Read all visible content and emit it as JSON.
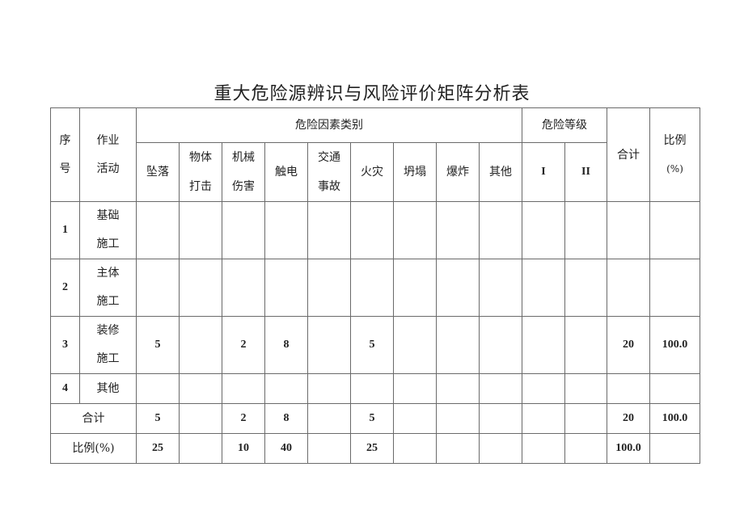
{
  "title": "重大危险源辨识与风险评价矩阵分析表",
  "header": {
    "seq": [
      "序",
      "号"
    ],
    "activity": [
      "作业",
      "活动"
    ],
    "hazard_group": "危险因素类别",
    "level_group": "危险等级",
    "total": "合计",
    "ratio": [
      "比例",
      "(%)"
    ],
    "hazard_types": [
      {
        "lines": [
          "坠落"
        ]
      },
      {
        "lines": [
          "物体",
          "打击"
        ]
      },
      {
        "lines": [
          "机械",
          "伤害"
        ]
      },
      {
        "lines": [
          "触电"
        ]
      },
      {
        "lines": [
          "交通",
          "事故"
        ]
      },
      {
        "lines": [
          "火灾"
        ]
      },
      {
        "lines": [
          "坍塌"
        ]
      },
      {
        "lines": [
          "爆炸"
        ]
      },
      {
        "lines": [
          "其他"
        ]
      }
    ],
    "levels": [
      "I",
      "II"
    ]
  },
  "rows": [
    {
      "seq": "1",
      "activity": [
        "基础",
        "施工"
      ],
      "values": [
        "",
        "",
        "",
        "",
        "",
        "",
        "",
        "",
        "",
        "",
        ""
      ],
      "total": "",
      "ratio": ""
    },
    {
      "seq": "2",
      "activity": [
        "主体",
        "施工"
      ],
      "values": [
        "",
        "",
        "",
        "",
        "",
        "",
        "",
        "",
        "",
        "",
        ""
      ],
      "total": "",
      "ratio": ""
    },
    {
      "seq": "3",
      "activity": [
        "装修",
        "施工"
      ],
      "values": [
        "5",
        "",
        "2",
        "8",
        "",
        "5",
        "",
        "",
        "",
        "",
        ""
      ],
      "total": "20",
      "ratio": "100.0"
    },
    {
      "seq": "4",
      "activity": [
        "其他"
      ],
      "values": [
        "",
        "",
        "",
        "",
        "",
        "",
        "",
        "",
        "",
        "",
        ""
      ],
      "total": "",
      "ratio": ""
    }
  ],
  "sum_row": {
    "label": "合计",
    "values": [
      "5",
      "",
      "2",
      "8",
      "",
      "5",
      "",
      "",
      "",
      "",
      ""
    ],
    "total": "20",
    "ratio": "100.0"
  },
  "ratio_row": {
    "label": "比例(%)",
    "values": [
      "25",
      "",
      "10",
      "40",
      "",
      "25",
      "",
      "",
      "",
      "",
      ""
    ],
    "total": "100.0",
    "ratio": ""
  }
}
